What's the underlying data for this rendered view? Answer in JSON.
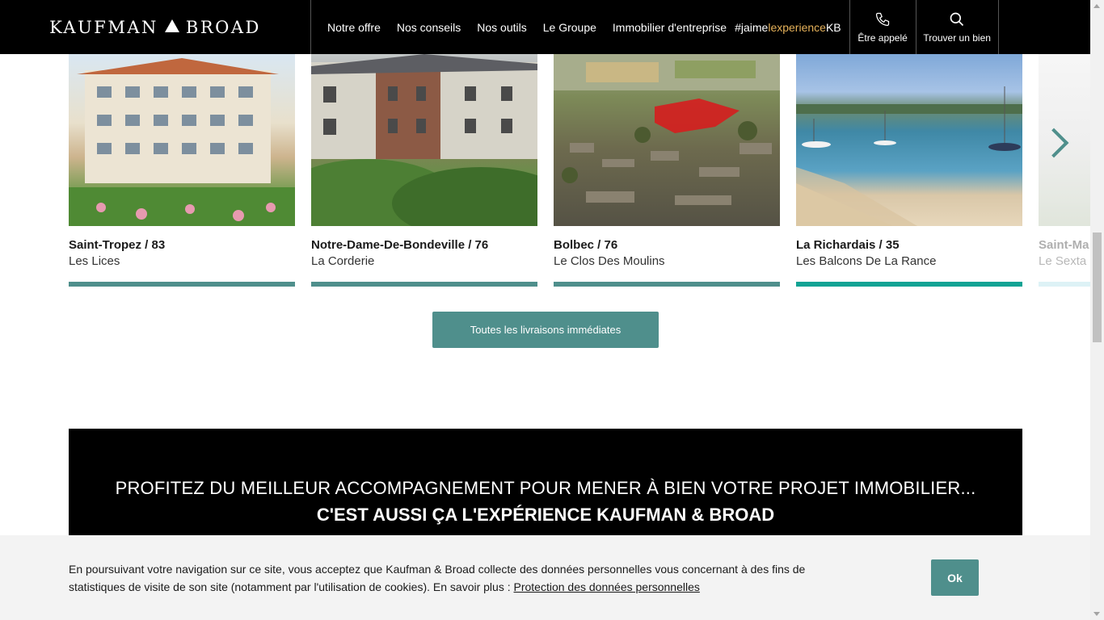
{
  "header": {
    "logo_left": "KAUFMAN",
    "logo_right": "BROAD",
    "nav": [
      "Notre offre",
      "Nos conseils",
      "Nos outils",
      "Le Groupe",
      "Immobilier d'entreprise"
    ],
    "hashtag": {
      "p1": "#jaime",
      "p2": "lexperience",
      "p3": "KB"
    },
    "call_label": "Être appelé",
    "find_label": "Trouver un bien"
  },
  "carousel": {
    "cards": [
      {
        "city": "Saint-Tropez / 83",
        "program": "Les Lices"
      },
      {
        "city": "Notre-Dame-De-Bondeville / 76",
        "program": "La Corderie"
      },
      {
        "city": "Bolbec / 76",
        "program": "Le Clos Des Moulins"
      },
      {
        "city": "La Richardais / 35",
        "program": "Les Balcons De La Rance"
      },
      {
        "city": "Saint-Ma",
        "program": "Le Sexta"
      }
    ]
  },
  "all_button": "Toutes les livraisons immédiates",
  "promo": {
    "line1": "PROFITEZ DU MEILLEUR ACCOMPAGNEMENT POUR MENER À BIEN VOTRE PROJET IMMOBILIER...",
    "line2": "C'EST AUSSI ÇA L'EXPÉRIENCE KAUFMAN & BROAD"
  },
  "cookie": {
    "text": "En poursuivant votre navigation sur ce site, vous acceptez que Kaufman & Broad collecte des données personnelles vous concernant à des fins de statistiques de visite de son site (notamment par l'utilisation de cookies). En savoir plus : ",
    "link": "Protection des données personnelles",
    "ok": "Ok"
  },
  "colors": {
    "accent": "#4f8f8c",
    "active": "#12a394",
    "hashtag": "#e6b25a"
  },
  "icons": [
    "phone-icon",
    "search-icon",
    "chevron-right-icon"
  ]
}
